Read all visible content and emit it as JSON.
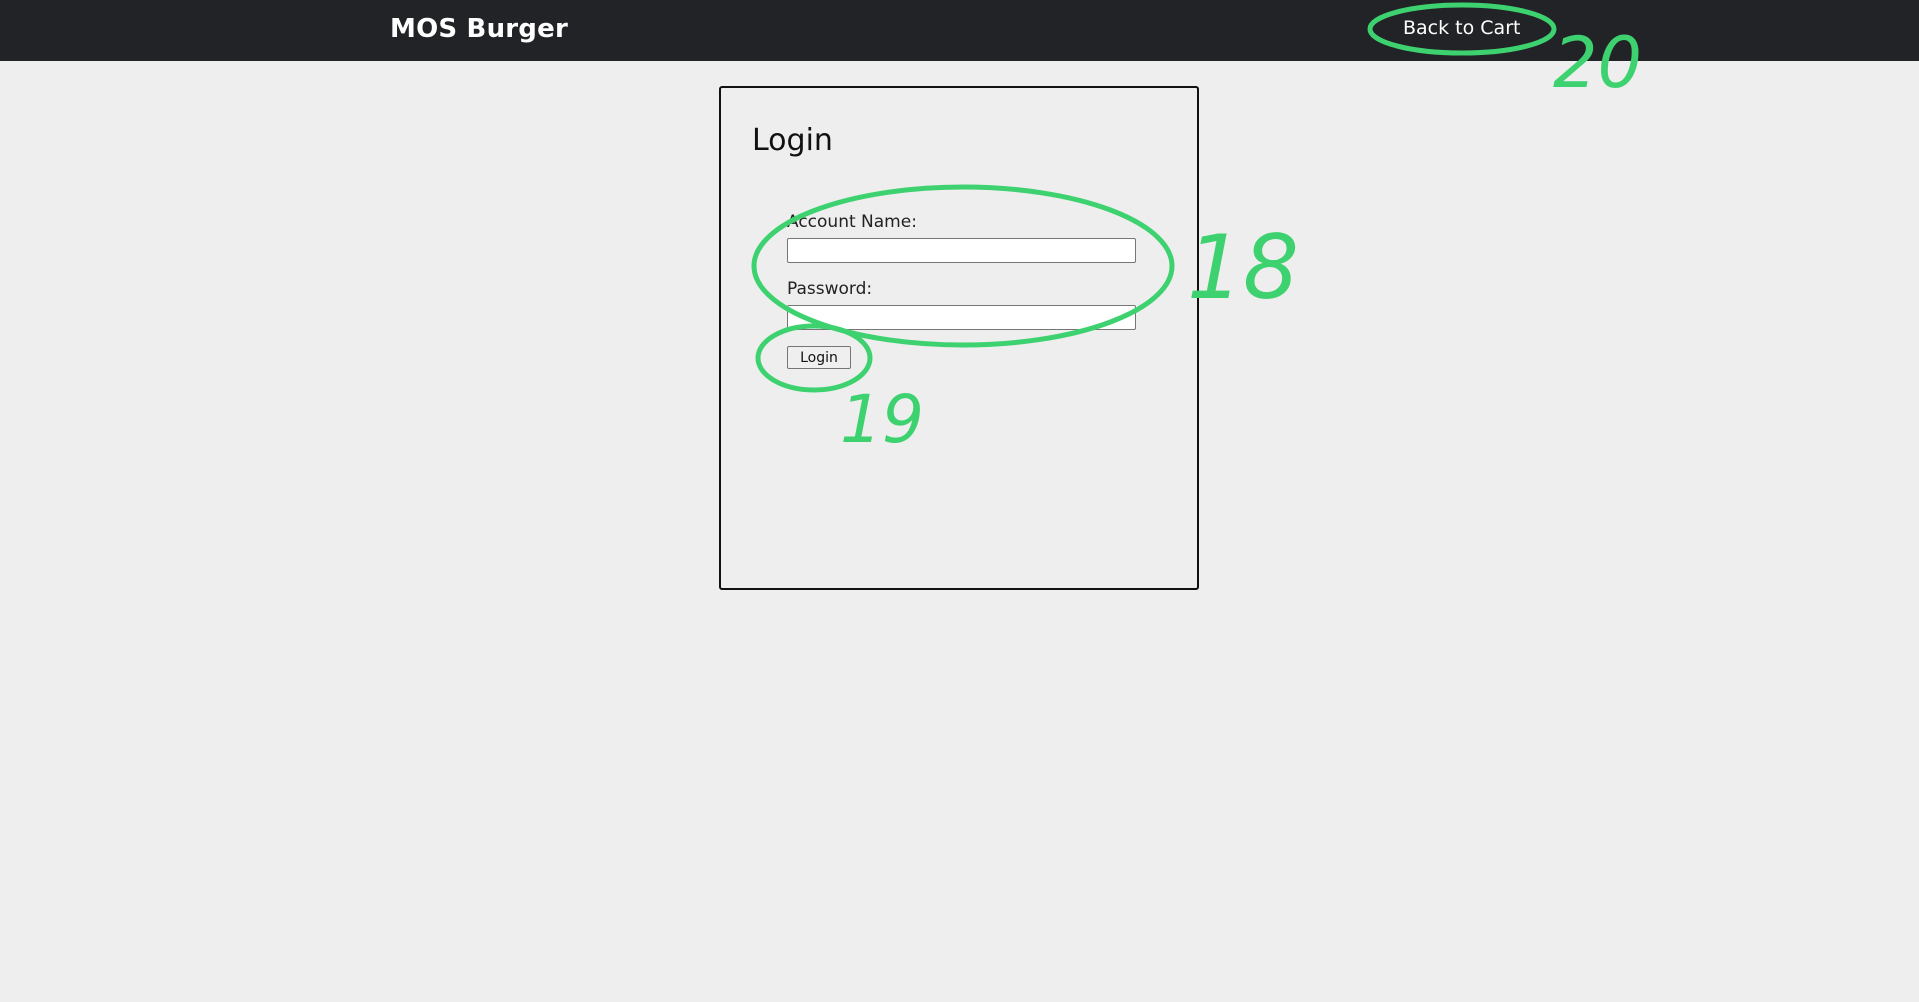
{
  "navbar": {
    "brand": "MOS Burger",
    "back_to_cart": "Back to Cart"
  },
  "login": {
    "title": "Login",
    "account_name_label": "Account Name:",
    "account_name_value": "",
    "password_label": "Password:",
    "password_value": "",
    "submit_label": "Login"
  },
  "annotations": {
    "color": "#3dd26f",
    "labels": [
      "18",
      "19",
      "20"
    ]
  }
}
